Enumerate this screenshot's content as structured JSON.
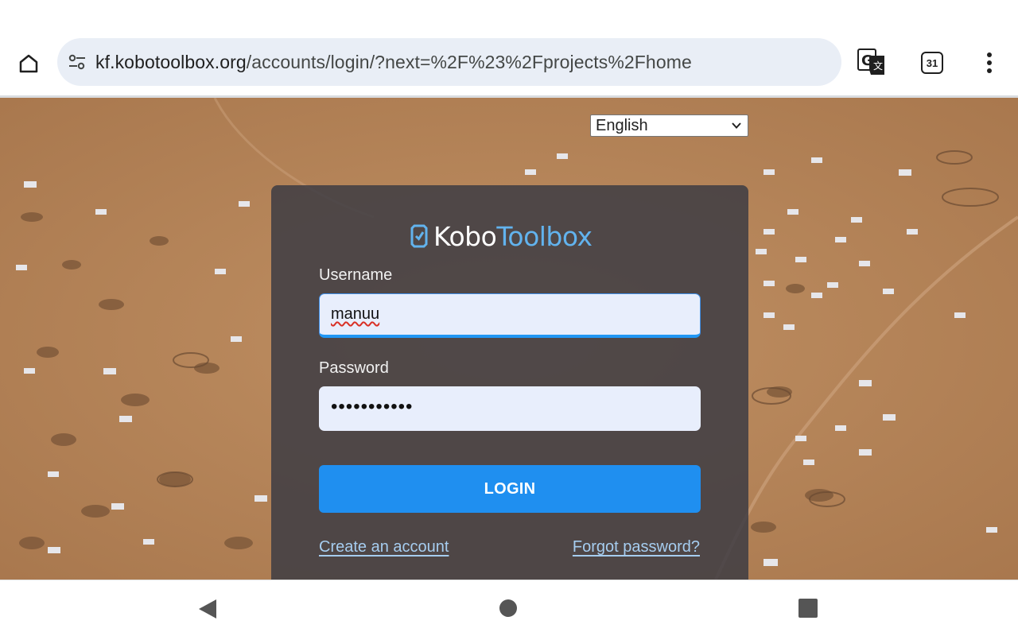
{
  "browser": {
    "url_host": "kf.kobotoolbox.org",
    "url_path": "/accounts/login/?next=%2F%23%2Fprojects%2Fhome",
    "tab_count": "31",
    "icons": {
      "home": "home-icon",
      "site_info": "tune-icon",
      "translate": "translate-icon",
      "tabs": "tab-switcher-icon",
      "menu": "more-vert-icon"
    }
  },
  "page": {
    "language_selected": "English",
    "logo_kobo": "Kobo",
    "logo_toolbox": "Toolbox",
    "username_label": "Username",
    "username_value": "manuu",
    "password_label": "Password",
    "password_value": "•••••••••••",
    "login_label": "LOGIN",
    "create_account": "Create an account",
    "forgot_password": "Forgot password?",
    "colors": {
      "accent": "#1f8ff0",
      "logo_blue": "#62b3ee",
      "card": "#3e3c44",
      "link": "#a6cdf0"
    }
  },
  "system_nav": {
    "icons": [
      "back-icon",
      "home-circle-icon",
      "recents-icon"
    ]
  }
}
